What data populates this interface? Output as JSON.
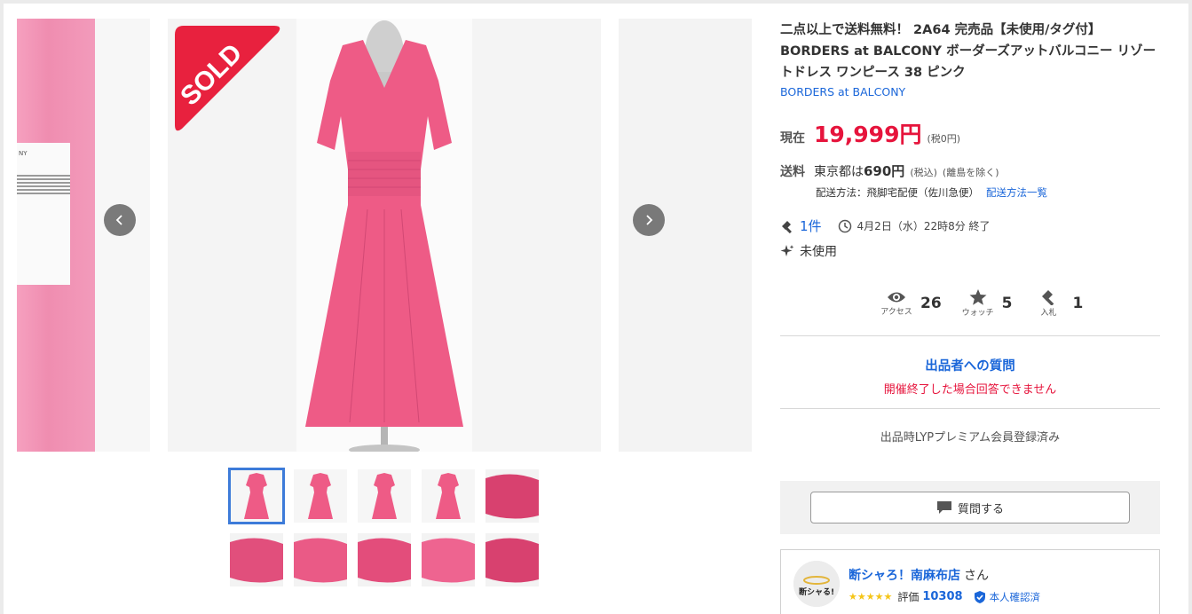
{
  "product": {
    "title": "二点以上で送料無料！ 2A64 完売品【未使用/タグ付】BORDERS at BALCONY ボーダーズアットバルコニー リゾートドレス ワンピース 38 ピンク",
    "brand": "BORDERS at BALCONY",
    "sold_badge": "SOLD",
    "price_label": "現在",
    "price": "19,999円",
    "tax_note": "(税0円)"
  },
  "shipping": {
    "label": "送料",
    "destination_prefix": "東京都は",
    "fee": "690円",
    "fee_note": "(税込)",
    "exclusion_note": "(離島を除く)",
    "method": "配送方法：飛脚宅配便（佐川急便）",
    "method_link": "配送方法一覧"
  },
  "auction": {
    "bids": "1件",
    "end_time": "4月2日（水）22時8分 終了",
    "condition": "未使用"
  },
  "stats": [
    {
      "label": "アクセス",
      "value": "26",
      "icon": "eye-icon"
    },
    {
      "label": "ウォッチ",
      "value": "5",
      "icon": "star-icon"
    },
    {
      "label": "入札",
      "value": "1",
      "icon": "gavel-icon"
    }
  ],
  "question": {
    "title": "出品者への質問",
    "note": "開催終了した場合回答できません",
    "button_label": "質問する"
  },
  "lyp_note": "出品時LYPプレミアム会員登録済み",
  "seller": {
    "name": "断シャろ！南麻布店",
    "honorific": "さん",
    "avatar_text": "断シャる!",
    "rating_label": "評価",
    "rating_value": "10308",
    "verified_label": "本人確認済"
  },
  "gallery": {
    "thumbnail_count": 10,
    "active_index": 0
  },
  "colors": {
    "accent_blue": "#1a66d9",
    "price_red": "#e6143c",
    "sold_red": "#e8213e",
    "dress_pink": "#ee5b86"
  }
}
